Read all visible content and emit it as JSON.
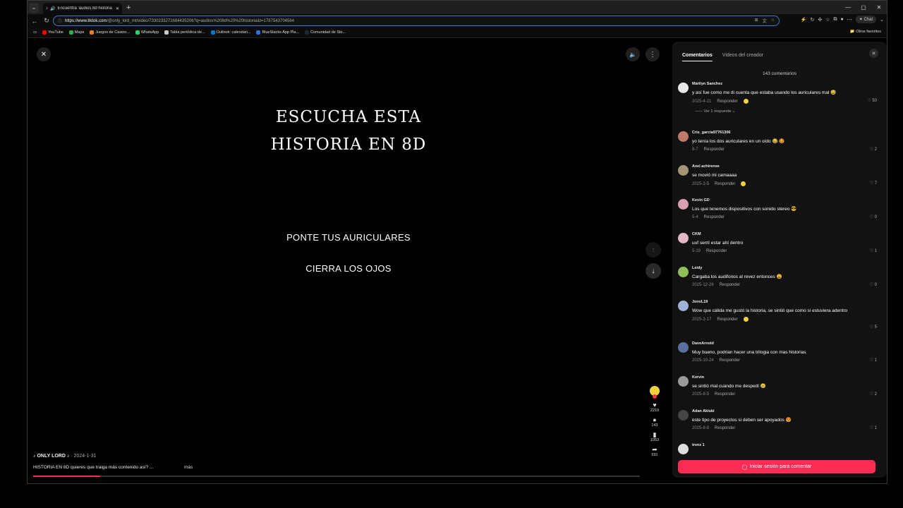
{
  "browser": {
    "tab_title": "Encuentra 'audios 8d historia",
    "url_host": "https://www.tiktok.com",
    "url_path": "/@only_lord_mt/video/7330233271684435206?q=audios%208d%20%20historia&t=1787543704564",
    "chat_label": "Chat",
    "bookmarks": [
      {
        "label": "YouTube",
        "color": "#ff0000"
      },
      {
        "label": "Maps",
        "color": "#34a853"
      },
      {
        "label": "Juegos de Casino...",
        "color": "#e67e22"
      },
      {
        "label": "WhatsApp",
        "color": "#25d366"
      },
      {
        "label": "Tabla periódica de...",
        "color": "#cccccc"
      },
      {
        "label": "Outlook: calendari...",
        "color": "#0078d4"
      },
      {
        "label": "BlueStacks App Pla...",
        "color": "#2f6fe0"
      },
      {
        "label": "Comunidad de Ste...",
        "color": "#1b2838"
      }
    ],
    "other_bookmarks": "Otros favoritos"
  },
  "video": {
    "title_line1": "ESCUCHA ESTA",
    "title_line2": "HISTORIA EN 8D",
    "line_headphones": "PONTE TUS AURICULARES",
    "line_eyes": "CIERRA LOS OJOS",
    "likes": "2219",
    "comments": "143",
    "saves": "1053",
    "shares": "591",
    "author": "♪ ONLY LORD ♪",
    "date": "· 2024-1-31",
    "caption": "HISTORIA EN 8D quieres que traiga más contenido así? ...",
    "more": "más",
    "progress": 0.11
  },
  "panel": {
    "tab_comments": "Comentarios",
    "tab_creator": "Videos del creador",
    "count": "143 comentarios",
    "comments": [
      {
        "name": "Marilyn Sanchez",
        "text": "y así fue como me di cuenta que estaba usando los auriculares mal 😅",
        "date": "2025-4-21",
        "reply": "Responder",
        "likes": "50",
        "avatar": "#e8e8e8",
        "creator_emoji": true,
        "replies": "Ver 1 respuesta ⌄"
      },
      {
        "name": "Cris_garcia97761306",
        "text": "yo tenía los dos auriculares en un oído 😂 🤩",
        "date": "8-7",
        "reply": "Responder",
        "likes": "2",
        "avatar": "#c07a6a",
        "creator_emoji": false
      },
      {
        "name": "Axel achirense",
        "text": "se movió mi camaaaa",
        "date": "2025-2-5",
        "reply": "Responder",
        "likes": "7",
        "avatar": "#a59478",
        "creator_emoji": true
      },
      {
        "name": "Kevin GD",
        "text": "Los que tenemos dispositivos con sonido stereo 😎",
        "date": "5-4",
        "reply": "Responder",
        "likes": "0",
        "avatar": "#d9a0b0",
        "creator_emoji": false
      },
      {
        "name": "CKM",
        "text": "uuf sentí estar ahí dentro",
        "date": "5-19",
        "reply": "Responder",
        "likes": "1",
        "avatar": "#e3b8c4",
        "creator_emoji": false
      },
      {
        "name": "Leidy",
        "text": "Cargaba los audifonos al revez entonces 😩",
        "date": "2025-12-26",
        "reply": "Responder",
        "likes": "0",
        "avatar": "#8fbf5a",
        "creator_emoji": false
      },
      {
        "name": "JonvL19",
        "text": "Wow que cálida me gustó la historia, se sintió que como si estuviera adentro",
        "date": "2025-2-17",
        "reply": "Responder",
        "likes": "5",
        "avatar": "#9fb3d8",
        "creator_emoji": true
      },
      {
        "name": "DaveArnold",
        "text": "Muy bueno, podrian hacer una trilogia con mas historias",
        "date": "2025-10-24",
        "reply": "Responder",
        "likes": "1",
        "avatar": "#5a6f9c",
        "creator_emoji": false
      },
      {
        "name": "Kervin",
        "text": "se sintió mal cuando me despedí 😢",
        "date": "2025-8-5",
        "reply": "Responder",
        "likes": "2",
        "avatar": "#9a9a9a",
        "creator_emoji": false
      },
      {
        "name": "Adan Akluki",
        "text": "este tipo de proyectos si deben ser apoyados 😍",
        "date": "2025-8-8",
        "reply": "Responder",
        "likes": "1",
        "avatar": "#444444",
        "creator_emoji": false
      },
      {
        "name": "trenz 1",
        "text": "",
        "date": "",
        "reply": "",
        "likes": "",
        "avatar": "#dddddd",
        "creator_emoji": false
      }
    ],
    "login_button": "Iniciar sesión para comentar"
  }
}
